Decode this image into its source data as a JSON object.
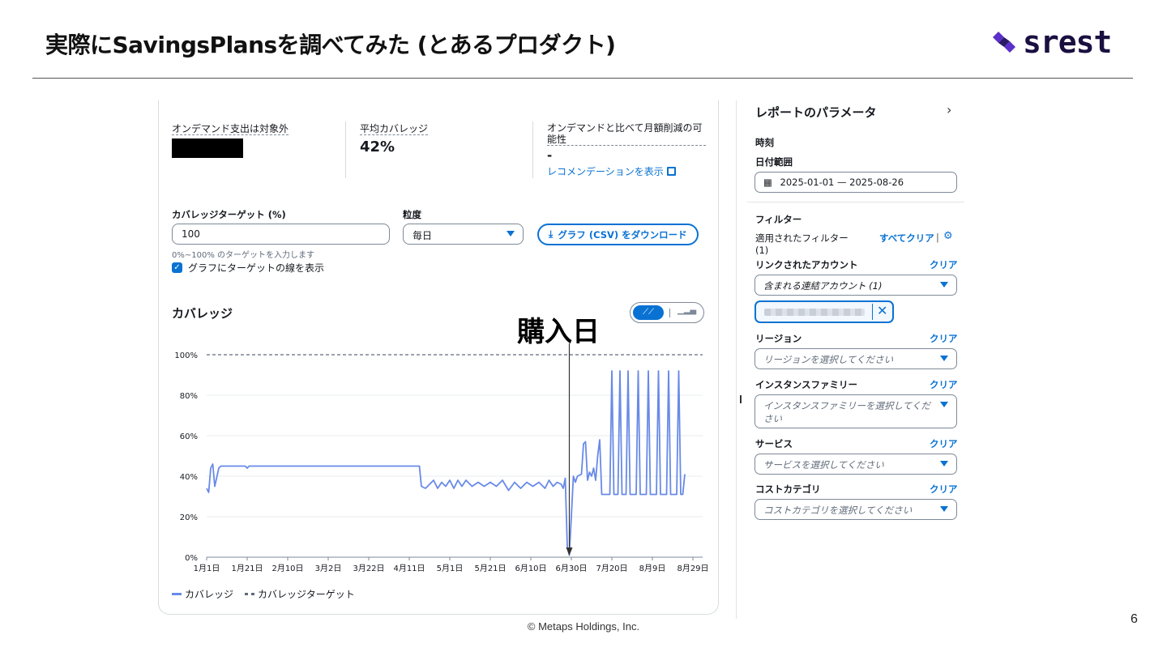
{
  "slide": {
    "title": "実際にSavingsPlansを調べてみた (とあるプロダクト)",
    "logo_text": "srest",
    "footer": "© Metaps Holdings,  Inc.",
    "page_number": "6"
  },
  "summary": {
    "ondemand_label": "オンデマンド支出は対象外",
    "avg_coverage_label": "平均カバレッジ",
    "avg_coverage_value": "42%",
    "savings_label_line1": "オンデマンドと比べて月額削減の可",
    "savings_label_line2": "能性",
    "savings_value": "-",
    "recommendation_link": "レコメンデーションを表示"
  },
  "controls": {
    "target_label": "カバレッジターゲット (%)",
    "target_value": "100",
    "target_hint": "0%~100% のターゲットを入力します",
    "show_target_label": "グラフにターゲットの線を表示",
    "granularity_label": "粒度",
    "granularity_value": "毎日",
    "download_label": "グラフ (CSV) をダウンロード"
  },
  "chart_heading": "カバレッジ",
  "annotation": "購入日",
  "chart_data": {
    "type": "line",
    "ylim": [
      0,
      100
    ],
    "y_ticks": [
      "0%",
      "20%",
      "40%",
      "60%",
      "80%",
      "100%"
    ],
    "x_ticks": [
      "1月1日",
      "1月21日",
      "2月10日",
      "3月2日",
      "3月22日",
      "4月11日",
      "5月1日",
      "5月21日",
      "6月10日",
      "6月30日",
      "7月20日",
      "8月9日",
      "8月29日"
    ],
    "x_range": [
      "2025-01-01",
      "2025-08-26"
    ],
    "series": [
      {
        "name": "カバレッジ",
        "color": "#688ae8",
        "points": [
          [
            "2025-01-01",
            34
          ],
          [
            "2025-01-02",
            32
          ],
          [
            "2025-01-03",
            44
          ],
          [
            "2025-01-04",
            46
          ],
          [
            "2025-01-05",
            35
          ],
          [
            "2025-01-07",
            44
          ],
          [
            "2025-01-08",
            45
          ],
          [
            "2025-01-20",
            45
          ],
          [
            "2025-01-21",
            44
          ],
          [
            "2025-01-22",
            45
          ],
          [
            "2025-02-01",
            45
          ],
          [
            "2025-02-15",
            45
          ],
          [
            "2025-03-01",
            45
          ],
          [
            "2025-03-15",
            45
          ],
          [
            "2025-04-01",
            45
          ],
          [
            "2025-04-16",
            45
          ],
          [
            "2025-04-17",
            35
          ],
          [
            "2025-04-19",
            34
          ],
          [
            "2025-04-21",
            36
          ],
          [
            "2025-04-23",
            38
          ],
          [
            "2025-04-25",
            34
          ],
          [
            "2025-04-27",
            37
          ],
          [
            "2025-04-29",
            35
          ],
          [
            "2025-05-01",
            38
          ],
          [
            "2025-05-03",
            34
          ],
          [
            "2025-05-05",
            38
          ],
          [
            "2025-05-07",
            35
          ],
          [
            "2025-05-09",
            38
          ],
          [
            "2025-05-12",
            35
          ],
          [
            "2025-05-15",
            37
          ],
          [
            "2025-05-18",
            35
          ],
          [
            "2025-05-21",
            37
          ],
          [
            "2025-05-24",
            35
          ],
          [
            "2025-05-27",
            38
          ],
          [
            "2025-05-30",
            33
          ],
          [
            "2025-06-02",
            37
          ],
          [
            "2025-06-05",
            34
          ],
          [
            "2025-06-08",
            37
          ],
          [
            "2025-06-11",
            35
          ],
          [
            "2025-06-14",
            37
          ],
          [
            "2025-06-17",
            34
          ],
          [
            "2025-06-19",
            38
          ],
          [
            "2025-06-21",
            35
          ],
          [
            "2025-06-23",
            37
          ],
          [
            "2025-06-25",
            36
          ],
          [
            "2025-06-26",
            34
          ],
          [
            "2025-06-27",
            39
          ],
          [
            "2025-06-28",
            5
          ],
          [
            "2025-06-29",
            1
          ],
          [
            "2025-06-30",
            20
          ],
          [
            "2025-07-01",
            40
          ],
          [
            "2025-07-02",
            37
          ],
          [
            "2025-07-03",
            40
          ],
          [
            "2025-07-05",
            41
          ],
          [
            "2025-07-06",
            56
          ],
          [
            "2025-07-07",
            57
          ],
          [
            "2025-07-08",
            38
          ],
          [
            "2025-07-09",
            42
          ],
          [
            "2025-07-10",
            40
          ],
          [
            "2025-07-11",
            44
          ],
          [
            "2025-07-12",
            38
          ],
          [
            "2025-07-13",
            50
          ],
          [
            "2025-07-14",
            58
          ],
          [
            "2025-07-15",
            31
          ],
          [
            "2025-07-17",
            31
          ],
          [
            "2025-07-18",
            31
          ],
          [
            "2025-07-19",
            31
          ],
          [
            "2025-07-20",
            92
          ],
          [
            "2025-07-21",
            31
          ],
          [
            "2025-07-22",
            31
          ],
          [
            "2025-07-23",
            31
          ],
          [
            "2025-07-24",
            92
          ],
          [
            "2025-07-25",
            31
          ],
          [
            "2025-07-26",
            31
          ],
          [
            "2025-07-27",
            31
          ],
          [
            "2025-07-28",
            92
          ],
          [
            "2025-07-29",
            31
          ],
          [
            "2025-07-30",
            31
          ],
          [
            "2025-07-31",
            31
          ],
          [
            "2025-08-01",
            31
          ],
          [
            "2025-08-02",
            92
          ],
          [
            "2025-08-03",
            31
          ],
          [
            "2025-08-04",
            31
          ],
          [
            "2025-08-05",
            31
          ],
          [
            "2025-08-06",
            31
          ],
          [
            "2025-08-07",
            92
          ],
          [
            "2025-08-08",
            31
          ],
          [
            "2025-08-09",
            31
          ],
          [
            "2025-08-10",
            31
          ],
          [
            "2025-08-11",
            31
          ],
          [
            "2025-08-12",
            92
          ],
          [
            "2025-08-13",
            31
          ],
          [
            "2025-08-14",
            31
          ],
          [
            "2025-08-15",
            31
          ],
          [
            "2025-08-16",
            31
          ],
          [
            "2025-08-17",
            92
          ],
          [
            "2025-08-18",
            31
          ],
          [
            "2025-08-19",
            31
          ],
          [
            "2025-08-20",
            31
          ],
          [
            "2025-08-21",
            31
          ],
          [
            "2025-08-22",
            92
          ],
          [
            "2025-08-23",
            31
          ],
          [
            "2025-08-24",
            31
          ],
          [
            "2025-08-25",
            41
          ]
        ]
      },
      {
        "name": "カバレッジターゲット",
        "color": "#5f6b7a",
        "dashed": true,
        "value": 100
      }
    ],
    "annotation_date": "2025-06-29",
    "grid": true,
    "legend_position": "bottom-left"
  },
  "panel": {
    "title": "レポートのパラメータ",
    "time_heading": "時刻",
    "date_range_label": "日付範囲",
    "date_range_value": "2025-01-01 — 2025-08-26",
    "filter_heading": "フィルター",
    "applied_filters_label": "適用されたフィルター",
    "applied_filters_count": "(1)",
    "clear_all": "すべてクリア",
    "clear": "クリア",
    "linked_account_label": "リンクされたアカウント",
    "linked_account_value": "含まれる連結アカウント (1)",
    "region_label": "リージョン",
    "region_placeholder": "リージョンを選択してください",
    "family_label": "インスタンスファミリー",
    "family_placeholder_1": "インスタンスファミリーを選択してくだ",
    "family_placeholder_2": "さい",
    "service_label": "サービス",
    "service_placeholder": "サービスを選択してください",
    "cost_category_label": "コストカテゴリ",
    "cost_category_placeholder": "コストカテゴリを選択してください"
  }
}
